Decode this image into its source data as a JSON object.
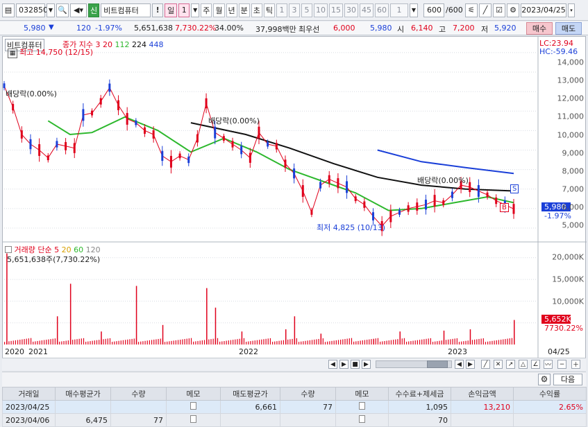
{
  "toolbar": {
    "code": "032850",
    "stock_badge": "신",
    "stock_name": "비트컴퓨터",
    "alert": "!",
    "period_sel": "일",
    "period_num": "1",
    "periods": [
      "주",
      "월",
      "년",
      "분",
      "초",
      "틱"
    ],
    "minutes": [
      "1",
      "3",
      "5",
      "10",
      "15",
      "30",
      "45",
      "60"
    ],
    "minute_sel": "1",
    "count": "600",
    "count_total": "/600",
    "date": "2023/04/25"
  },
  "quote": {
    "price": "5,980",
    "change_arrow": "▼",
    "change": "120",
    "change_pct": "-1.97%",
    "volume": "5,651,638",
    "turnover_pct": "7,730.22%",
    "ratio": "34.00%",
    "amount": "37,998백만",
    "best_label": "최우선",
    "best_ask": "6,000",
    "best_bid": "5,980",
    "open_label": "시",
    "open": "6,140",
    "high_label": "고",
    "high": "7,200",
    "low_label": "저",
    "low": "5,920",
    "buy_btn": "매수",
    "sell_btn": "매도"
  },
  "chart_data": [
    {
      "type": "candlestick",
      "title": "비트컴퓨터",
      "legend": {
        "label": "종가 지수",
        "periods": [
          "3",
          "20",
          "112",
          "224",
          "448"
        ],
        "colors": [
          "#e0001b",
          "#2db82d",
          "#111111",
          "#1a3fd8"
        ]
      },
      "y_ticks": [
        "14,000",
        "13,000",
        "12,000",
        "11,000",
        "10,000",
        "9,000",
        "8,000",
        "7,000",
        "6,000",
        "5,000"
      ],
      "ylim": [
        4500,
        14600
      ],
      "x_labels": [
        "2020",
        "2021",
        "2022",
        "2023"
      ],
      "last_date_label": "04/25",
      "right_info": {
        "lc": "LC:23.94",
        "hc": "HC:-59.46"
      },
      "current_price": "5,980",
      "current_change": "-1.97%",
      "annotations": {
        "high": "최고 14,750 (12/15)",
        "low": "최저 4,825 (10/13)",
        "dividend1": "배당락(0.00%)",
        "dividend2": "배당락(0.00%)",
        "dividend3": "배당락(0.00%)",
        "marker_s": "S",
        "marker_b": "B"
      },
      "close_path_est": [
        [
          0,
          12300
        ],
        [
          8,
          11200
        ],
        [
          16,
          9800
        ],
        [
          24,
          9300
        ],
        [
          32,
          9000
        ],
        [
          40,
          8600
        ],
        [
          48,
          9300
        ],
        [
          56,
          9200
        ],
        [
          64,
          9100
        ],
        [
          72,
          10800
        ],
        [
          80,
          10900
        ],
        [
          88,
          11500
        ],
        [
          96,
          12200
        ],
        [
          104,
          11300
        ],
        [
          112,
          10600
        ],
        [
          120,
          10400
        ],
        [
          128,
          10000
        ],
        [
          136,
          9800
        ],
        [
          144,
          8700
        ],
        [
          152,
          8400
        ],
        [
          160,
          8700
        ],
        [
          168,
          8500
        ],
        [
          176,
          9600
        ],
        [
          184,
          11400
        ],
        [
          192,
          9900
        ],
        [
          200,
          9600
        ],
        [
          208,
          9300
        ],
        [
          216,
          9000
        ],
        [
          224,
          8600
        ],
        [
          232,
          9900
        ],
        [
          240,
          9300
        ],
        [
          248,
          9200
        ],
        [
          256,
          8300
        ],
        [
          264,
          7800
        ],
        [
          272,
          6900
        ],
        [
          280,
          5800
        ],
        [
          288,
          7200
        ],
        [
          296,
          7500
        ],
        [
          304,
          7300
        ],
        [
          312,
          7100
        ],
        [
          320,
          6500
        ],
        [
          328,
          6200
        ],
        [
          336,
          5600
        ],
        [
          344,
          5100
        ],
        [
          352,
          5600
        ],
        [
          360,
          5800
        ],
        [
          368,
          6000
        ],
        [
          376,
          6100
        ],
        [
          384,
          6200
        ],
        [
          392,
          6400
        ],
        [
          400,
          6300
        ],
        [
          408,
          6700
        ],
        [
          416,
          7200
        ],
        [
          424,
          7100
        ],
        [
          432,
          6900
        ],
        [
          440,
          6700
        ],
        [
          448,
          6400
        ],
        [
          456,
          6200
        ],
        [
          464,
          5980
        ]
      ],
      "ma20_est": [
        [
          40,
          10500
        ],
        [
          60,
          9800
        ],
        [
          80,
          9900
        ],
        [
          110,
          10700
        ],
        [
          140,
          10000
        ],
        [
          170,
          8900
        ],
        [
          200,
          9600
        ],
        [
          230,
          8900
        ],
        [
          260,
          8000
        ],
        [
          290,
          7400
        ],
        [
          320,
          6800
        ],
        [
          350,
          5900
        ],
        [
          380,
          6000
        ],
        [
          410,
          6300
        ],
        [
          440,
          6600
        ],
        [
          464,
          6300
        ]
      ],
      "ma112_est": [
        [
          170,
          10400
        ],
        [
          220,
          9800
        ],
        [
          260,
          9100
        ],
        [
          300,
          8300
        ],
        [
          340,
          7600
        ],
        [
          380,
          7200
        ],
        [
          420,
          7000
        ],
        [
          464,
          6900
        ]
      ],
      "ma224_est": [
        [
          340,
          9000
        ],
        [
          380,
          8400
        ],
        [
          420,
          8100
        ],
        [
          464,
          7800
        ]
      ]
    },
    {
      "type": "bar",
      "title": "거래량",
      "legend": {
        "label": "단순",
        "periods": [
          "5",
          "20",
          "60",
          "120"
        ],
        "colors": [
          "#e0001b",
          "#d8a000",
          "#2db82d",
          "#888888"
        ]
      },
      "volume_label": "5,651,638주(7,730.22%)",
      "y_ticks": [
        "20,000K",
        "15,000K",
        "10,000K",
        "5,000K"
      ],
      "ylim": [
        0,
        23000
      ],
      "current_volume": "5,652K",
      "current_pct": "7730.22%",
      "spikes_est_k": [
        [
          2,
          21000
        ],
        [
          48,
          6500
        ],
        [
          60,
          14000
        ],
        [
          88,
          3000
        ],
        [
          120,
          13500
        ],
        [
          144,
          4500
        ],
        [
          184,
          13000
        ],
        [
          192,
          8500
        ],
        [
          216,
          3000
        ],
        [
          256,
          3500
        ],
        [
          264,
          6500
        ],
        [
          288,
          2500
        ],
        [
          336,
          1200
        ],
        [
          360,
          3000
        ],
        [
          400,
          3200
        ],
        [
          424,
          3500
        ],
        [
          464,
          5652
        ]
      ]
    }
  ],
  "ledger": {
    "settings_btn": "⚙",
    "next_btn": "다음",
    "columns": [
      "거래일",
      "매수평균가",
      "수량",
      "메모",
      "매도평균가",
      "수량",
      "메모",
      "수수료+제세금",
      "손익금액",
      "수익률"
    ],
    "rows": [
      {
        "date": "2023/04/25",
        "buy_avg": "",
        "buy_qty": "",
        "sell_avg": "6,661",
        "sell_qty": "77",
        "fee": "1,095",
        "pnl": "13,210",
        "ret": "2.65%"
      },
      {
        "date": "2023/04/06",
        "buy_avg": "6,475",
        "buy_qty": "77",
        "sell_avg": "",
        "sell_qty": "",
        "fee": "70",
        "pnl": "",
        "ret": ""
      }
    ]
  }
}
